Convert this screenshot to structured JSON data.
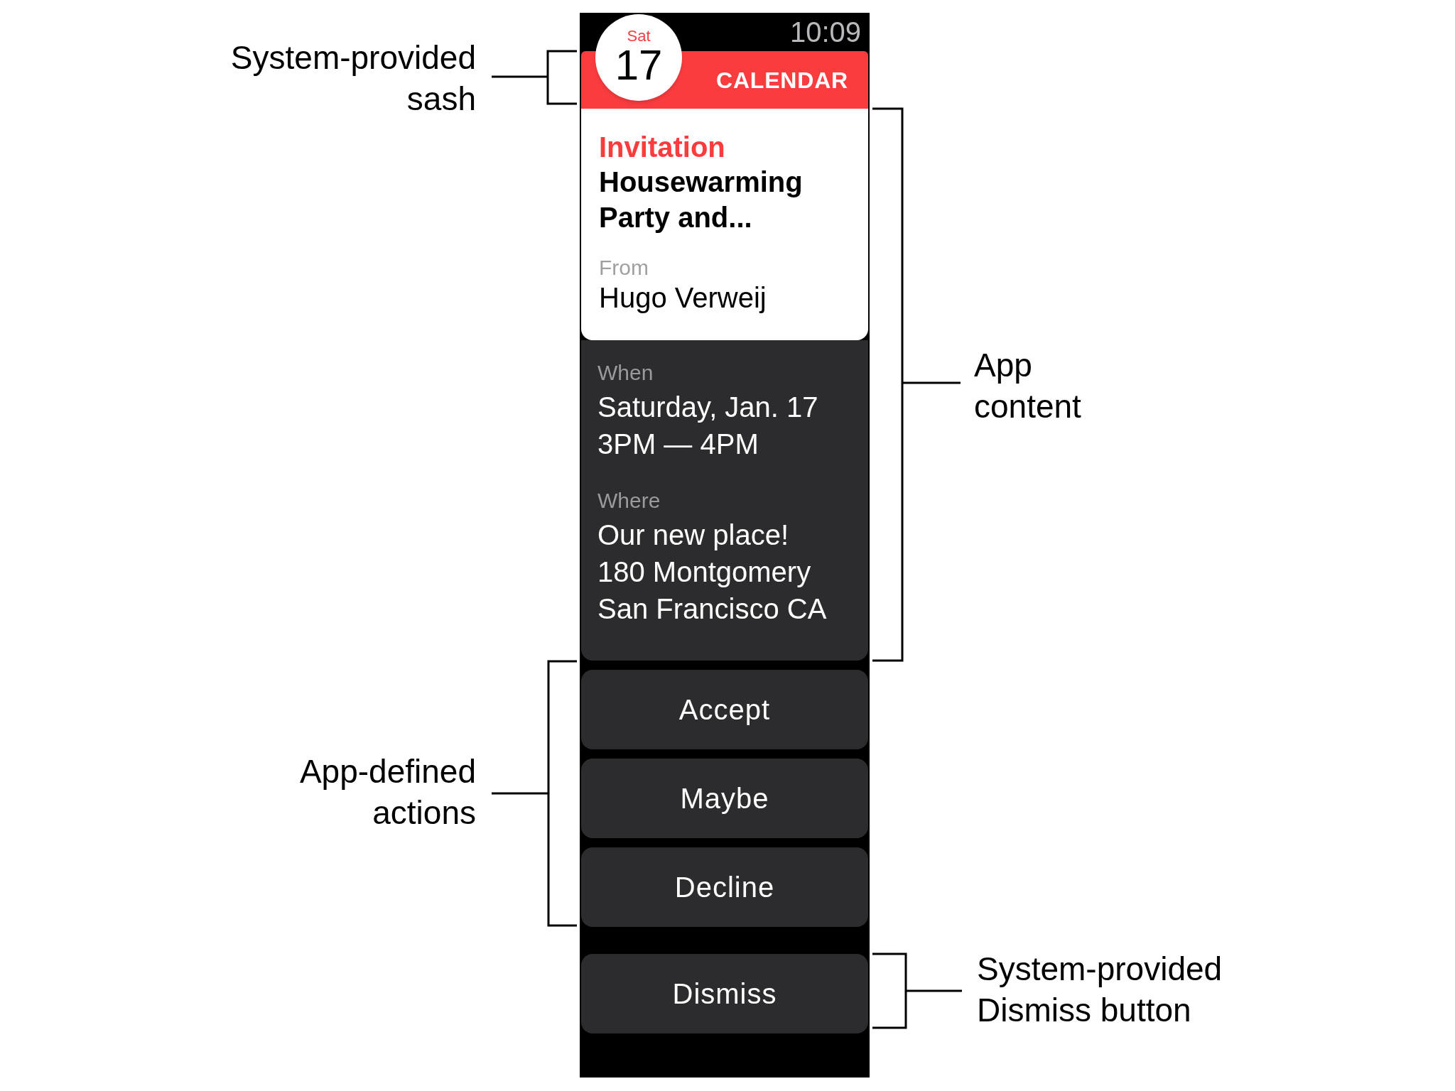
{
  "watch": {
    "time": "10:09",
    "sash": {
      "day": "Sat",
      "date": "17",
      "app": "CALENDAR"
    },
    "card": {
      "kind": "Invitation",
      "title_lines": [
        "Housewarming",
        "Party and..."
      ],
      "from_label": "From",
      "from": "Hugo Verweij"
    },
    "details": [
      {
        "label": "When",
        "lines": [
          "Saturday, Jan. 17",
          "3PM — 4PM"
        ]
      },
      {
        "label": "Where",
        "lines": [
          "Our new place!",
          "180 Montgomery",
          "San Francisco CA"
        ]
      }
    ],
    "actions": [
      "Accept",
      "Maybe",
      "Decline"
    ],
    "dismiss": "Dismiss"
  },
  "annotations": [
    {
      "kind": "left",
      "lines": [
        "System-provided",
        "sash"
      ]
    },
    {
      "kind": "right",
      "lines": [
        "App",
        "content"
      ]
    },
    {
      "kind": "left",
      "lines": [
        "App-defined",
        "actions"
      ]
    },
    {
      "kind": "right",
      "lines": [
        "System-provided",
        "Dismiss button"
      ]
    }
  ]
}
